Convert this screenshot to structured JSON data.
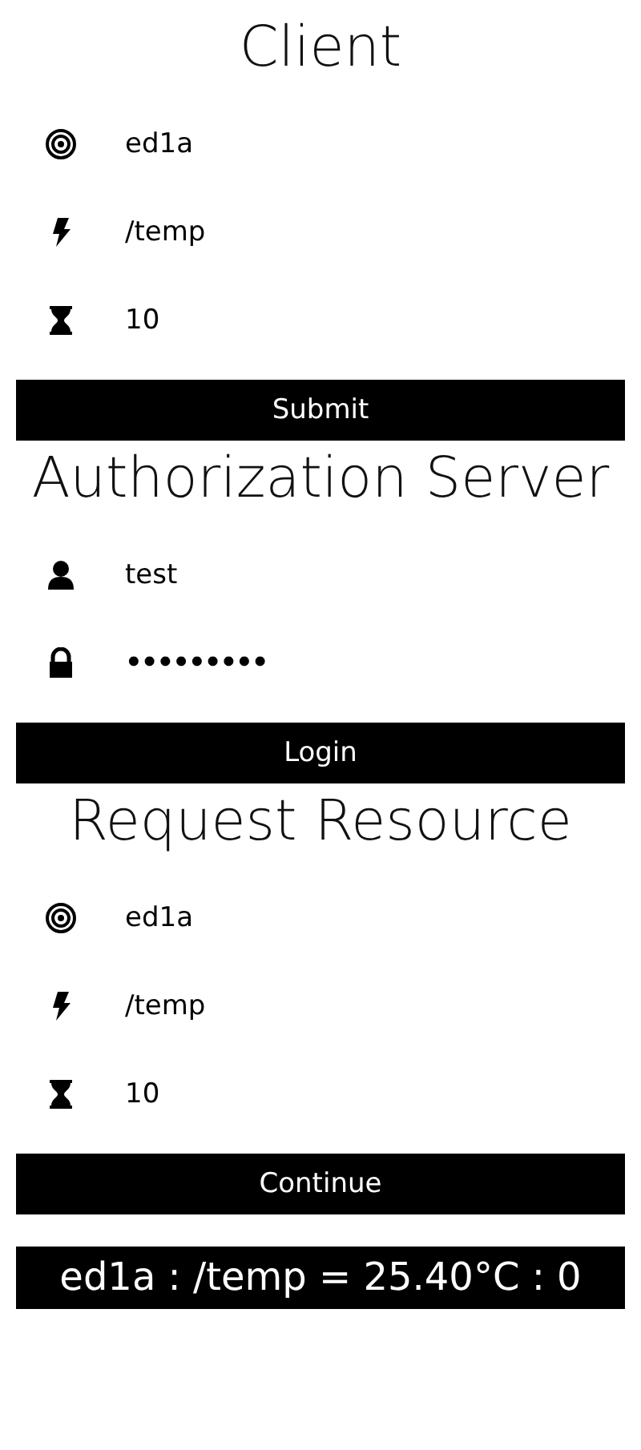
{
  "sections": [
    {
      "title": "Client",
      "fields": [
        {
          "kind": "target",
          "value": "ed1a"
        },
        {
          "kind": "bolt",
          "value": "/temp"
        },
        {
          "kind": "hourglass",
          "value": "10"
        }
      ],
      "button": "Submit"
    },
    {
      "title": "Authorization Server",
      "fields": [
        {
          "kind": "user",
          "value": "test"
        },
        {
          "kind": "lock",
          "value": "•••••••••"
        }
      ],
      "button": "Login"
    },
    {
      "title": "Request Resource",
      "fields": [
        {
          "kind": "target",
          "value": "ed1a"
        },
        {
          "kind": "bolt",
          "value": "/temp"
        },
        {
          "kind": "hourglass",
          "value": "10"
        }
      ],
      "button": "Continue"
    }
  ],
  "result": "ed1a : /temp = 25.40°C : 0"
}
